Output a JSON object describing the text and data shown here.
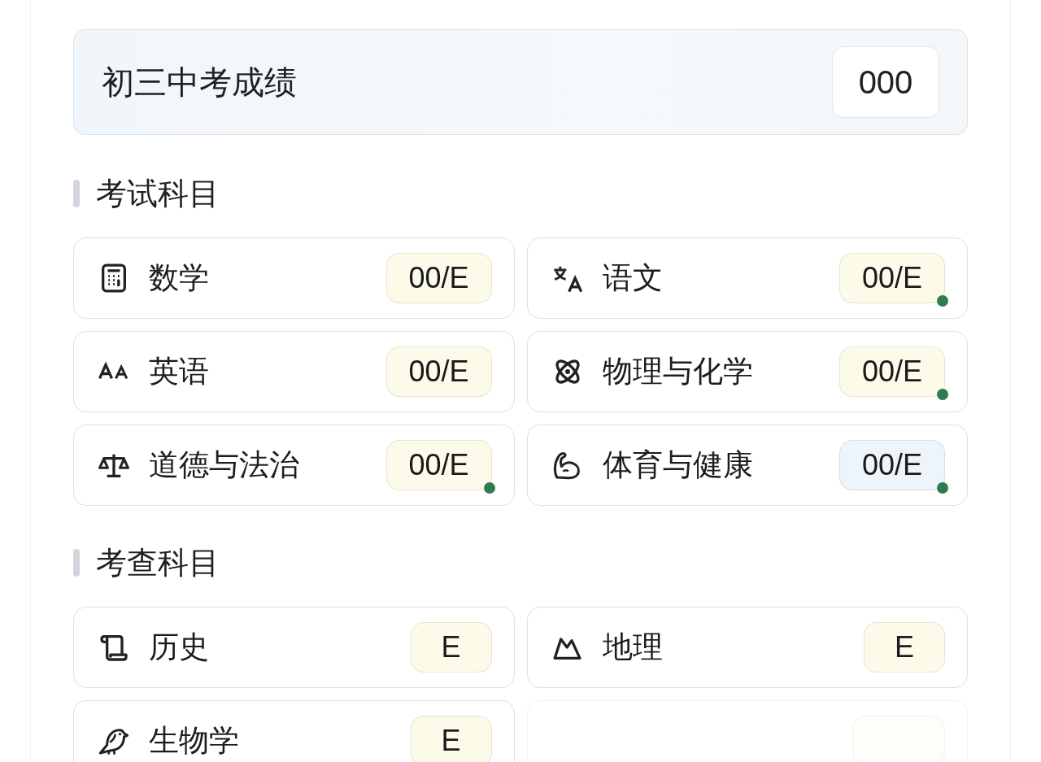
{
  "header": {
    "title": "初三中考成绩",
    "total": "000"
  },
  "sections": [
    {
      "title": "考试科目",
      "subjects": [
        {
          "kind": "subject",
          "name": "数学",
          "score": "00/E",
          "color": "#fcfbea",
          "marked": false
        },
        {
          "kind": "subject",
          "name": "语文",
          "score": "00/E",
          "color": "#fcfbea",
          "marked": true
        },
        {
          "kind": "subject",
          "name": "英语",
          "score": "00/E",
          "color": "#fcfbea",
          "marked": false
        },
        {
          "kind": "subject",
          "name": "物理与化学",
          "score": "00/E",
          "color": "#fcfbea",
          "marked": true
        },
        {
          "kind": "subject",
          "name": "道德与法治",
          "score": "00/E",
          "color": "#fcfbea",
          "marked": true
        },
        {
          "kind": "subject",
          "name": "体育与健康",
          "score": "00/E",
          "color": "#eef5fa",
          "marked": true
        }
      ]
    },
    {
      "title": "考查科目",
      "subjects": [
        {
          "kind": "subject",
          "name": "历史",
          "score": "E",
          "color": "#fcfbea",
          "marked": false
        },
        {
          "kind": "subject",
          "name": "地理",
          "score": "E",
          "color": "#fcfbea",
          "marked": false
        },
        {
          "kind": "subject",
          "name": "生物学",
          "score": "E",
          "color": "#fcfbea",
          "marked": false
        },
        {
          "kind": "faded"
        }
      ]
    }
  ]
}
